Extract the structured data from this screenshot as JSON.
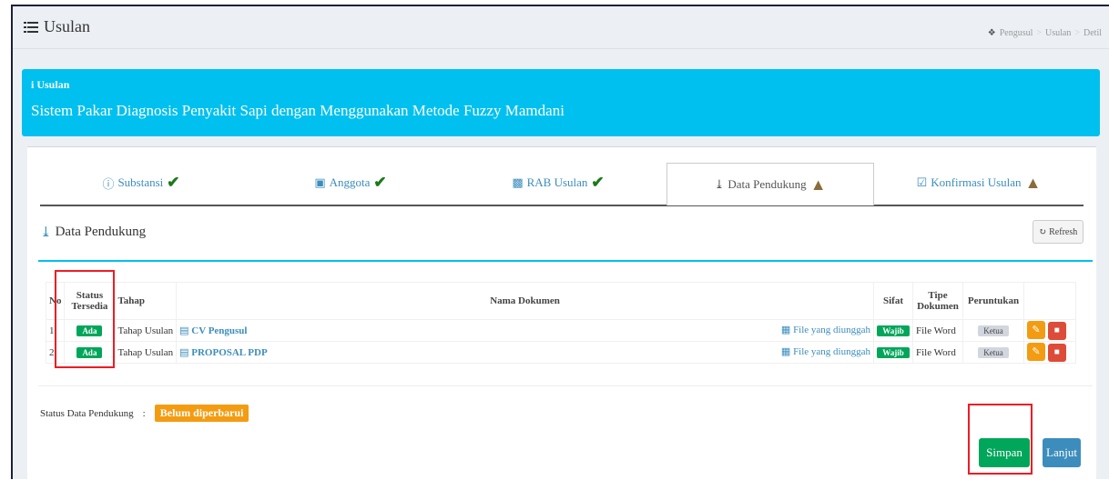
{
  "header": {
    "title": "Usulan",
    "icon": "list-icon"
  },
  "breadcrumb": [
    "Pengusul",
    "Usulan",
    "Detil"
  ],
  "callout": {
    "heading": "Usulan",
    "text": "Sistem Pakar Diagnosis Penyakit Sapi dengan Menggunakan Metode Fuzzy Mamdani"
  },
  "tabs": [
    {
      "label": "Substansi",
      "status": "done"
    },
    {
      "label": "Anggota",
      "status": "done"
    },
    {
      "label": "RAB Usulan",
      "status": "done"
    },
    {
      "label": "Data Pendukung",
      "status": "warning",
      "active": true
    },
    {
      "label": "Konfirmasi Usulan",
      "status": "warning"
    }
  ],
  "section": {
    "title": "Data Pendukung",
    "refresh_label": "Refresh"
  },
  "table": {
    "headers": {
      "no": "No",
      "status": "Status Tersedia",
      "tahap": "Tahap",
      "nama": "Nama Dokumen",
      "sifat": "Sifat",
      "tipe": "Tipe Dokumen",
      "peruntukan": "Peruntukan"
    },
    "rows": [
      {
        "no": "1",
        "status": "Ada",
        "tahap": "Tahap Usulan",
        "nama": "CV Pengusul",
        "file": "File yang diunggah",
        "sifat": "Wajib",
        "tipe": "File Word",
        "peruntukan": "Ketua"
      },
      {
        "no": "2",
        "status": "Ada",
        "tahap": "Tahap Usulan",
        "nama": "PROPOSAL PDP",
        "file": "File yang diunggah",
        "sifat": "Wajib",
        "tipe": "File Word",
        "peruntukan": "Ketua"
      }
    ]
  },
  "status": {
    "label": "Status Data Pendukung",
    "colon": ":",
    "value": "Belum diperbarui"
  },
  "buttons": {
    "simpan": "Simpan",
    "lanjut": "Lanjut"
  },
  "colors": {
    "callout": "#00c0ef",
    "green": "#00a65a",
    "orange": "#f39c12",
    "red": "#dd4b39",
    "blue": "#3c8dbc",
    "highlight": "#ee1c24"
  }
}
